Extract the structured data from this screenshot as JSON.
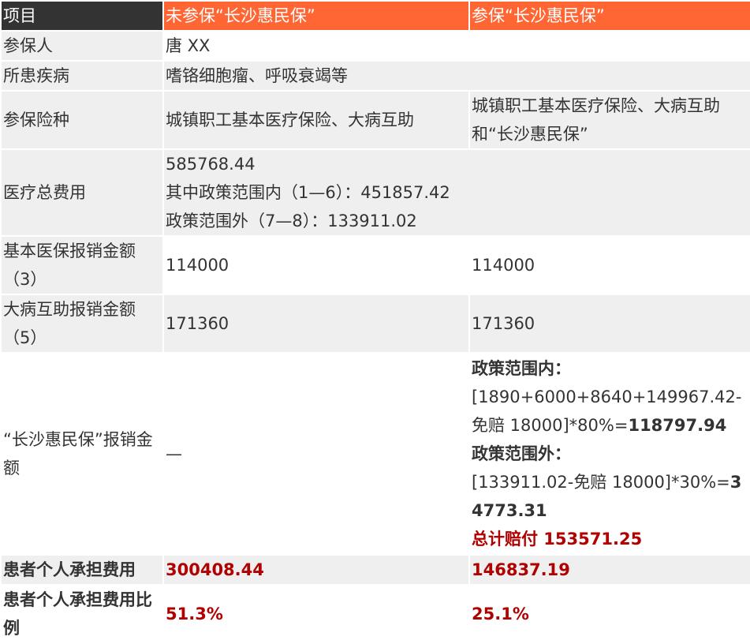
{
  "header": {
    "col0": "项目",
    "col1": "未参保“长沙惠民保”",
    "col2": "参保“长沙惠民保”"
  },
  "rows": {
    "insured": {
      "label": "参保人",
      "value": "唐 XX"
    },
    "disease": {
      "label": "所患疾病",
      "value": "嗜铬细胞瘤、呼吸衰竭等"
    },
    "insurance_type": {
      "label": "参保险种",
      "col1": "城镇职工基本医疗保险、大病互助",
      "col2": "城镇职工基本医疗保险、大病互助和“长沙惠民保”"
    },
    "total_cost": {
      "label": "医疗总费用",
      "line1": "585768.44",
      "line2": "其中政策范围内（1—6）：451857.42",
      "line3": "政策范围外（7—8）：133911.02"
    },
    "basic_reimbursement": {
      "label": "基本医保报销金额（3）",
      "col1": "114000",
      "col2": "114000"
    },
    "critical_reimbursement": {
      "label": "大病互助报销金额（5）",
      "col1": "171360",
      "col2": "171360"
    },
    "huiminbao_reimbursement": {
      "label": "“长沙惠民保”报销金额",
      "col1": "—",
      "in_policy_title": "政策范围内：",
      "in_policy_formula": "[1890+6000+8640+149967.42-免赔 18000]*80%=",
      "in_policy_result": "118797.94",
      "out_policy_title": "政策范围外：",
      "out_policy_formula": "[133911.02-免赔 18000]*30%=",
      "out_policy_result": "34773.31",
      "total": "总计赔付 153571.25"
    },
    "personal_cost": {
      "label": "患者个人承担费用",
      "col1": "300408.44",
      "col2": "146837.19"
    },
    "personal_ratio": {
      "label": "患者个人承担费用比例",
      "col1": "51.3%",
      "col2": "25.1%"
    }
  },
  "colors": {
    "header_dark": "#333333",
    "header_accent": "#ff6633",
    "row_gray": "#efefef",
    "highlight_red": "#b00000"
  }
}
